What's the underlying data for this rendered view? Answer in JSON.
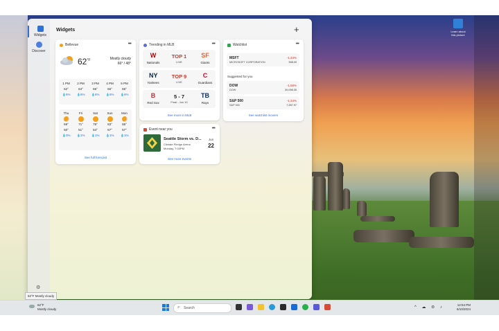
{
  "board": {
    "title": "Widgets"
  },
  "rail": [
    {
      "label": "Widgets"
    },
    {
      "label": "Discover"
    }
  ],
  "weather": {
    "location": "Bellevue",
    "temp": "62",
    "unit": "°F",
    "condition": "Mostly cloudy",
    "hilo": "66° / 48°",
    "hourly": [
      {
        "time": "1 PM",
        "temp": "62°",
        "precip": "6%"
      },
      {
        "time": "2 PM",
        "temp": "64°",
        "precip": "6%"
      },
      {
        "time": "3 PM",
        "temp": "66°",
        "precip": "6%"
      },
      {
        "time": "4 PM",
        "temp": "66°",
        "precip": "6%"
      },
      {
        "time": "5 PM",
        "temp": "66°",
        "precip": "6%"
      }
    ],
    "daily": [
      {
        "day": "Thu",
        "hi": "69°",
        "lo": "50°",
        "precip": "0%",
        "icon": "partly-sunny-icon"
      },
      {
        "day": "Fri",
        "hi": "71°",
        "lo": "51°",
        "precip": "1%",
        "icon": "sun-icon"
      },
      {
        "day": "Sat",
        "hi": "78°",
        "lo": "54°",
        "precip": "1%",
        "icon": "sun-icon"
      },
      {
        "day": "Sun",
        "hi": "83°",
        "lo": "57°",
        "precip": "1%",
        "icon": "sun-icon"
      },
      {
        "day": "Mon",
        "hi": "86°",
        "lo": "57°",
        "precip": "1%",
        "icon": "partly-sunny-icon"
      }
    ],
    "link": "See full forecast"
  },
  "mlb": {
    "title": "Trending in MLB",
    "games": [
      {
        "home": "Nationals",
        "away": "Giants",
        "score": "TOP 1",
        "status": "LIVE",
        "home_logo": "W",
        "away_logo": "SF",
        "home_color": "#ab0003",
        "away_color": "#fd5a1e",
        "live": true
      },
      {
        "home": "Yankees",
        "away": "Guardians",
        "score": "TOP 9",
        "status": "LIVE",
        "home_logo": "NY",
        "away_logo": "C",
        "home_color": "#0c2340",
        "away_color": "#d50032",
        "live": true
      },
      {
        "home": "Red Sox",
        "away": "Rays",
        "score": "5 - 7",
        "status": "Final - Jun 10",
        "home_logo": "B",
        "away_logo": "TB",
        "home_color": "#bd3039",
        "away_color": "#092c5c",
        "live": false
      }
    ],
    "link": "See more in MLB"
  },
  "watchlist": {
    "title": "Watchlist",
    "items": [
      {
        "symbol": "MSFT",
        "name": "MICROSOFT CORPORATION",
        "change": "-1.34%",
        "price": "398.09"
      }
    ],
    "suggested_label": "Suggested for you",
    "suggested": [
      {
        "symbol": "DOW",
        "name": "DOW",
        "change": "-1.68%",
        "price": "30,098.35"
      },
      {
        "symbol": "S&P 500",
        "name": "S&P 500",
        "change": "-1.34%",
        "price": "7,287.97"
      }
    ],
    "link": "See watchlist movers"
  },
  "event": {
    "header": "Event near you",
    "title": "Seattle Storm vs. D...",
    "venue": "Climate Pledge Arena",
    "time": "Monday, 7:00PM",
    "month": "Jun",
    "day": "22",
    "link": "See more events"
  },
  "desktop_icon": {
    "label": "Learn about this picture"
  },
  "tooltip": "62°F Mostly cloudy",
  "taskbar": {
    "weather_temp": "62°F",
    "weather_cond": "Mostly cloudy",
    "search_placeholder": "Search",
    "time": "12:54 PM",
    "date": "6/10/2024"
  },
  "colors": {
    "accent": "#2f6fd6",
    "negative": "#c43a2a",
    "live": "#c43a2a"
  }
}
